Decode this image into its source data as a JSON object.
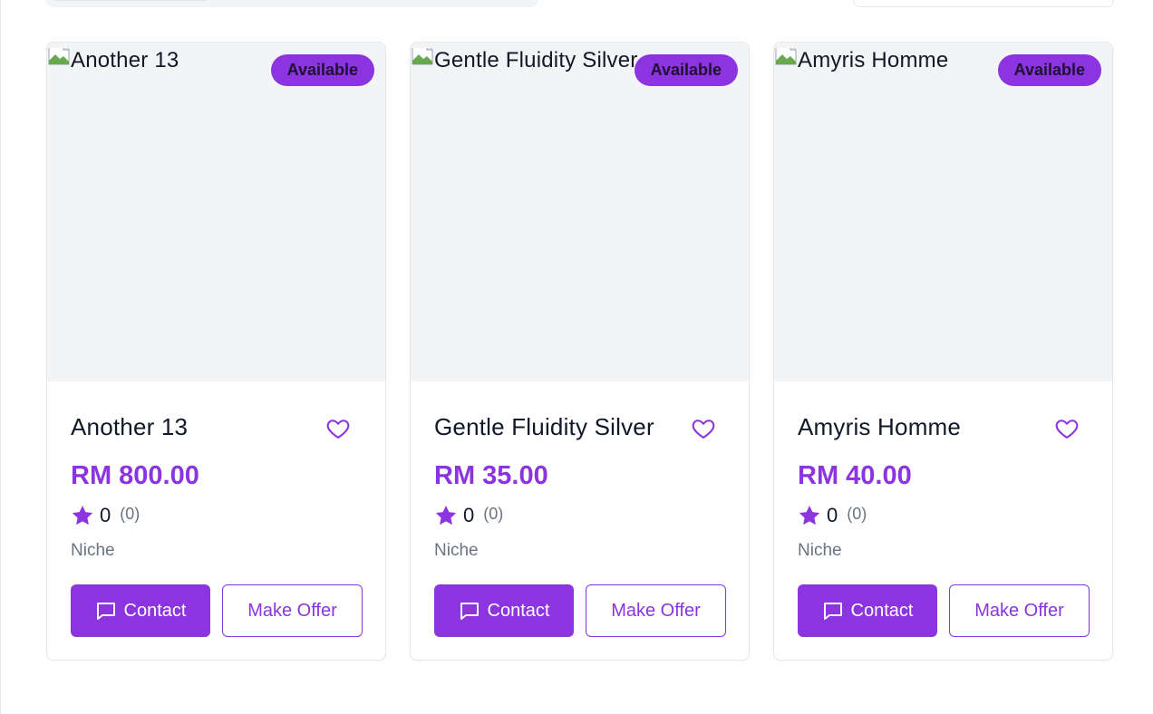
{
  "colors": {
    "accent": "#8b34e0",
    "image_bg": "#f3f4f6",
    "border": "#e5e7eb"
  },
  "products": [
    {
      "image_alt": "Another 13",
      "badge": "Available",
      "title": "Another 13",
      "price": "RM 800.00",
      "rating": "0",
      "rating_count": "(0)",
      "category": "Niche",
      "contact_label": "Contact",
      "offer_label": "Make Offer"
    },
    {
      "image_alt": "Gentle Fluidity Silver",
      "badge": "Available",
      "title": "Gentle Fluidity Silver",
      "price": "RM 35.00",
      "rating": "0",
      "rating_count": "(0)",
      "category": "Niche",
      "contact_label": "Contact",
      "offer_label": "Make Offer"
    },
    {
      "image_alt": "Amyris Homme",
      "badge": "Available",
      "title": "Amyris Homme",
      "price": "RM 40.00",
      "rating": "0",
      "rating_count": "(0)",
      "category": "Niche",
      "contact_label": "Contact",
      "offer_label": "Make Offer"
    }
  ]
}
